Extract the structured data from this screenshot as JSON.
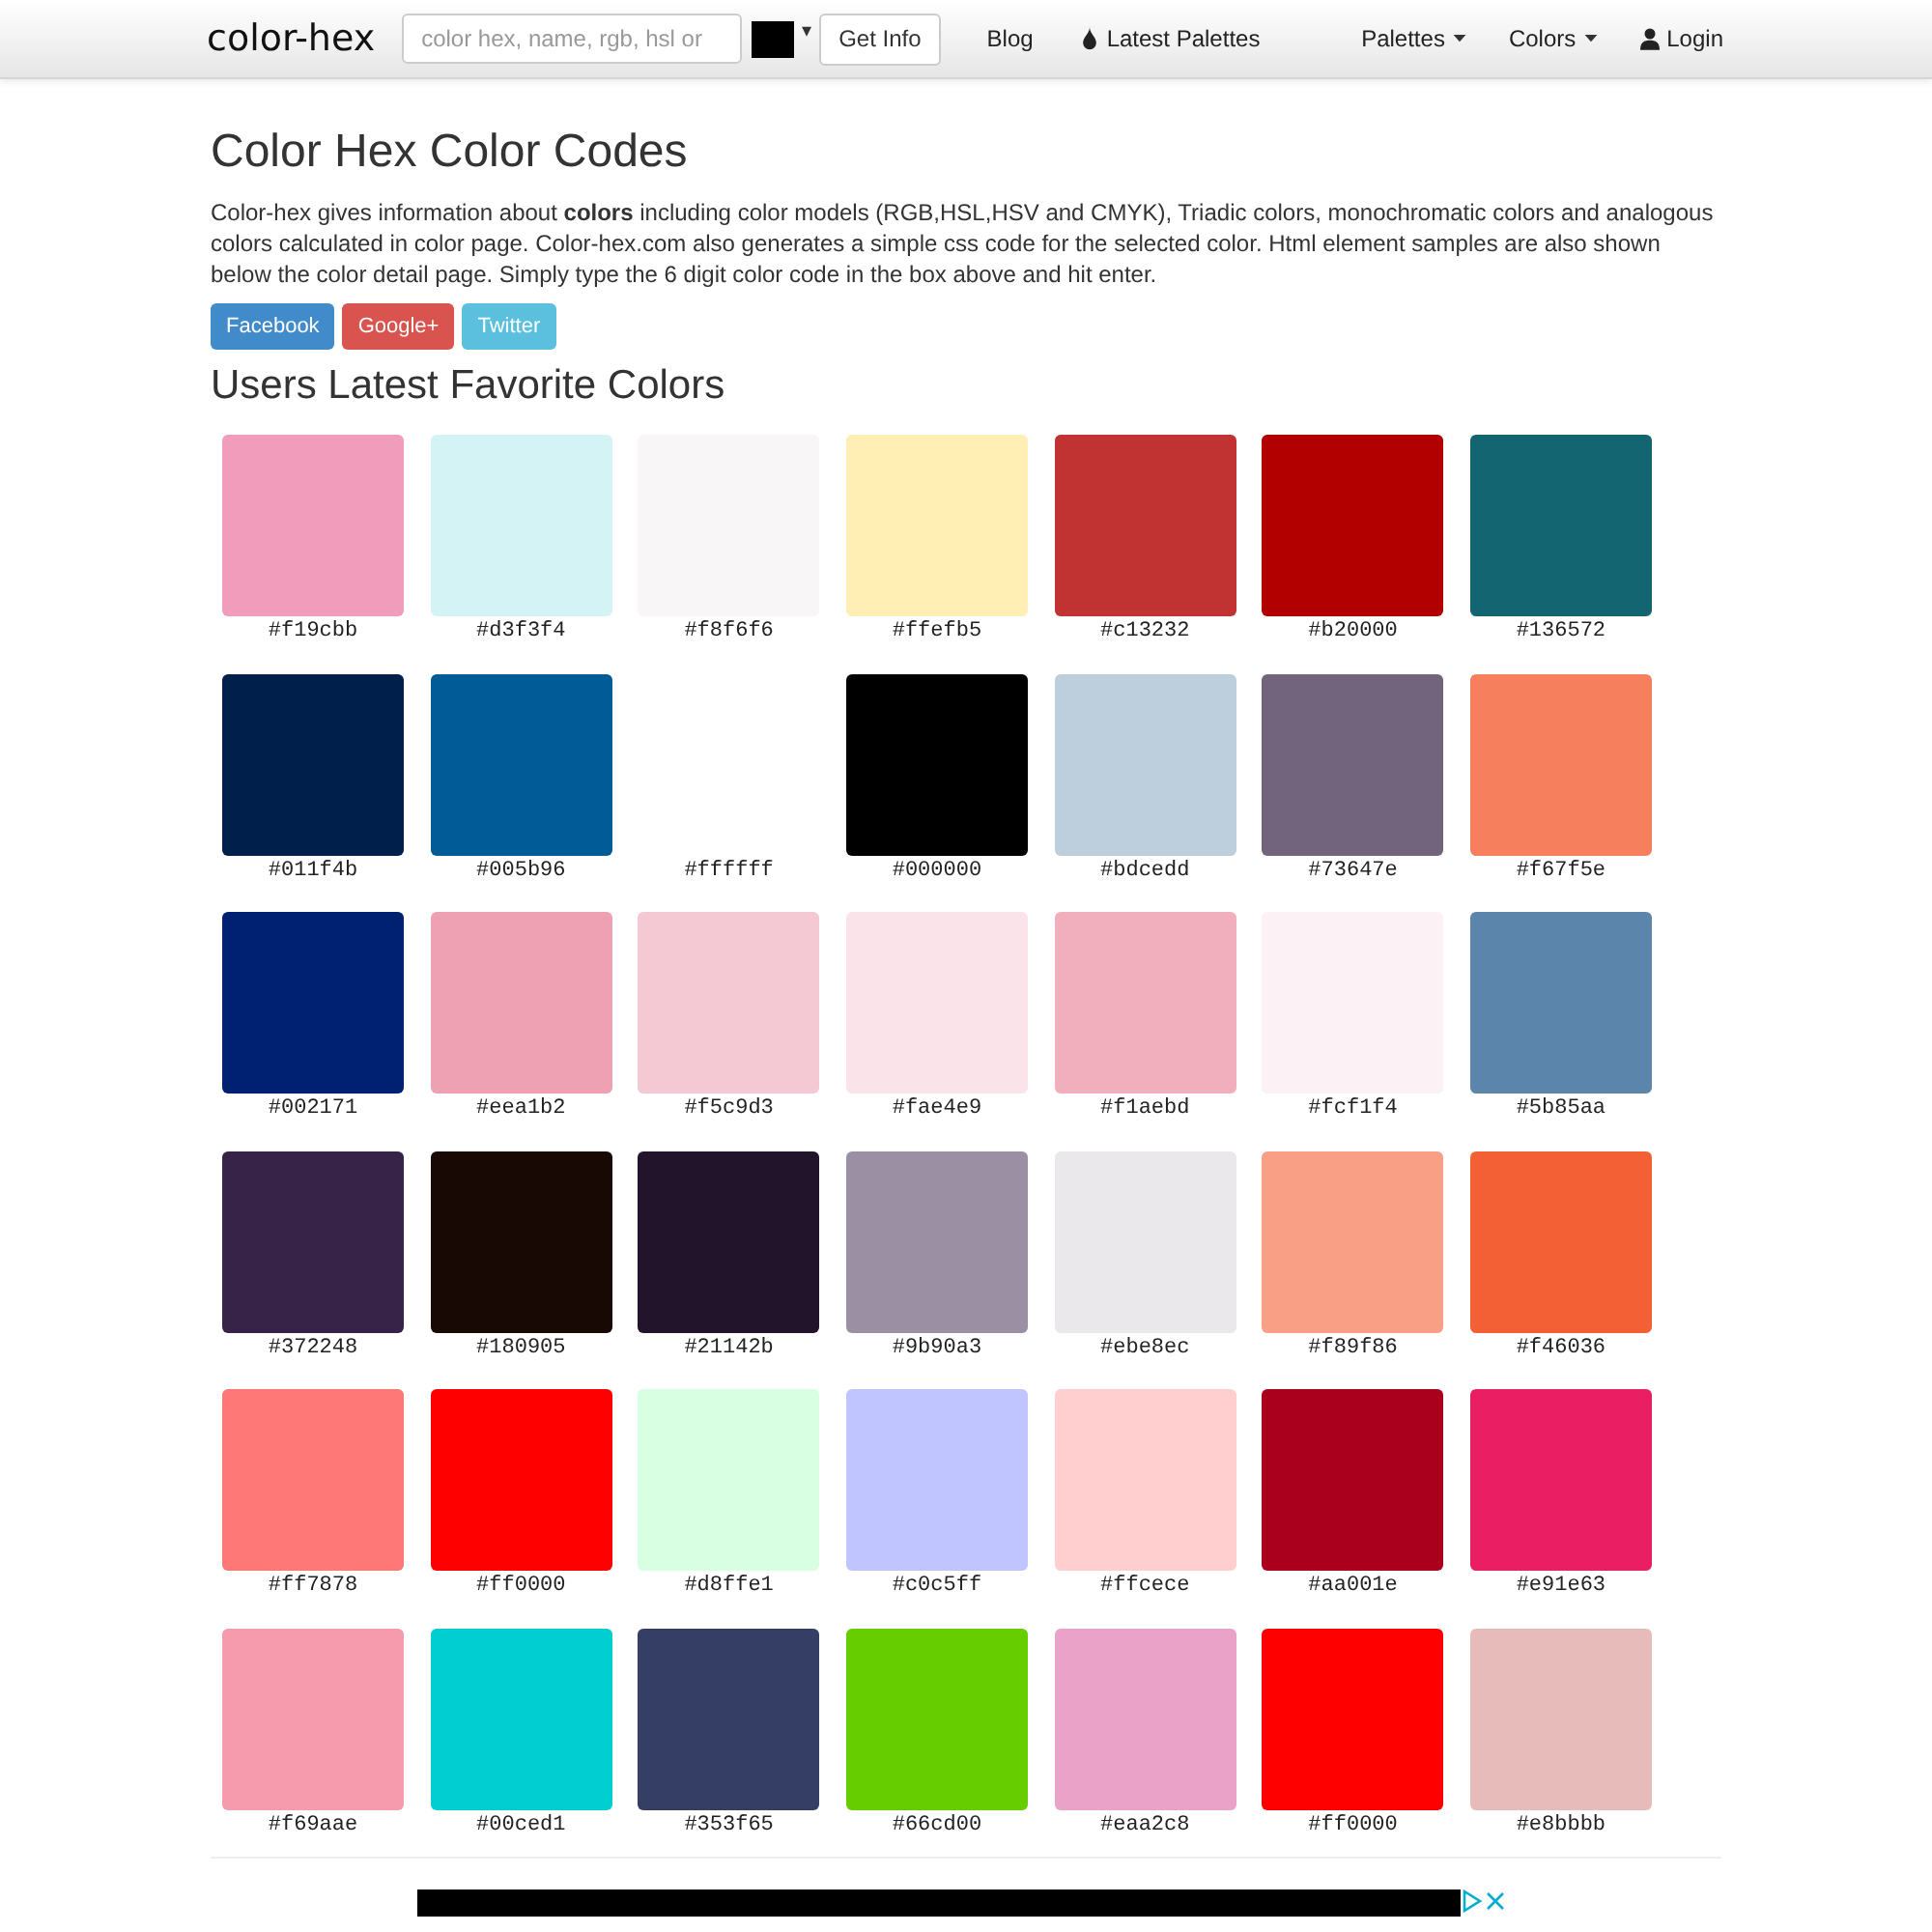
{
  "navbar": {
    "logo": "color-hex",
    "search": {
      "placeholder": "color hex, name, rgb, hsl or"
    },
    "caret": "▾",
    "submit": "Get Info",
    "links": [
      {
        "label": "Blog",
        "kind": "plain"
      },
      {
        "label": "Latest Palettes",
        "kind": "drop"
      }
    ],
    "right_links": [
      {
        "label": "Palettes",
        "kind": "menu"
      },
      {
        "label": "Colors",
        "kind": "menu"
      },
      {
        "label": "Login",
        "kind": "user"
      }
    ]
  },
  "title": "Color Hex Color Codes",
  "intro": "Color-hex gives information about **colors** including color models (RGB,HSL,HSV and CMYK), Triadic colors, monochromatic colors and analogous colors calculated in color page. Color-hex.com also generates a simple css code for the selected color. Html element samples are also shown below the color detail page. Simply type the 6 digit color code in the box above and hit enter.",
  "share_buttons": [
    {
      "label": "Facebook",
      "color": "#428bca"
    },
    {
      "label": "Google+",
      "color": "#d9534f"
    },
    {
      "label": "Twitter",
      "color": "#5bc0de"
    }
  ],
  "section_title": "Users Latest Favorite Colors",
  "colors": [
    {
      "label": "#f19cbb",
      "color": "#f19cbb"
    },
    {
      "label": "#d3f3f4",
      "color": "#d3f3f4"
    },
    {
      "label": "#f8f6f6",
      "color": "#f8f6f6"
    },
    {
      "label": "#ffefb5",
      "color": "#ffefb5"
    },
    {
      "label": "#c13232",
      "color": "#c13232"
    },
    {
      "label": "#b20000",
      "color": "#b20000"
    },
    {
      "label": "#136572",
      "color": "#136572"
    },
    {
      "label": "#011f4b",
      "color": "#011f4b"
    },
    {
      "label": "#005b96",
      "color": "#005b96"
    },
    {
      "label": "#ffffff"
    },
    {
      "label": "#000000",
      "color": "#000000"
    },
    {
      "label": "#bdcedd",
      "color": "#bdcedd"
    },
    {
      "label": "#73647e",
      "color": "#73647e"
    },
    {
      "label": "#f67f5e",
      "color": "#f67f5e"
    },
    {
      "label": "#002171",
      "color": "#002171"
    },
    {
      "label": "#eea1b2",
      "color": "#eea1b2"
    },
    {
      "label": "#f5c9d3",
      "color": "#f5c9d3"
    },
    {
      "label": "#fae4e9",
      "color": "#fae4e9"
    },
    {
      "label": "#f1aebd",
      "color": "#f1aebd"
    },
    {
      "label": "#fcf1f4",
      "color": "#fcf1f4"
    },
    {
      "label": "#5b85aa",
      "color": "#5b85aa"
    },
    {
      "label": "#372248",
      "color": "#372248"
    },
    {
      "label": "#180905",
      "color": "#180905"
    },
    {
      "label": "#21142b",
      "color": "#21142b"
    },
    {
      "label": "#9b90a3",
      "color": "#9b90a3"
    },
    {
      "label": "#ebe8ec",
      "color": "#ebe8ec"
    },
    {
      "label": "#f89f86",
      "color": "#f89f86"
    },
    {
      "label": "#f46036",
      "color": "#f46036"
    },
    {
      "label": "#ff7878",
      "color": "#ff7878"
    },
    {
      "label": "#ff0000",
      "color": "#ff0000"
    },
    {
      "label": "#d8ffe1",
      "color": "#d8ffe1"
    },
    {
      "label": "#c0c5ff",
      "color": "#c0c5ff"
    },
    {
      "label": "#ffcece",
      "color": "#ffcece"
    },
    {
      "label": "#aa001e",
      "color": "#aa001e"
    },
    {
      "label": "#e91e63",
      "color": "#e91e63"
    },
    {
      "label": "#f69aae",
      "color": "#f69aae"
    },
    {
      "label": "#00ced1",
      "color": "#00ced1"
    },
    {
      "label": "#353f65",
      "color": "#353f65"
    },
    {
      "label": "#66cd00",
      "color": "#66cd00"
    },
    {
      "label": "#eaa2c8",
      "color": "#eaa2c8"
    },
    {
      "label": "#ff0000",
      "color": "#ff0000"
    },
    {
      "label": "#e8bbbb",
      "color": "#e8bbbb"
    }
  ]
}
